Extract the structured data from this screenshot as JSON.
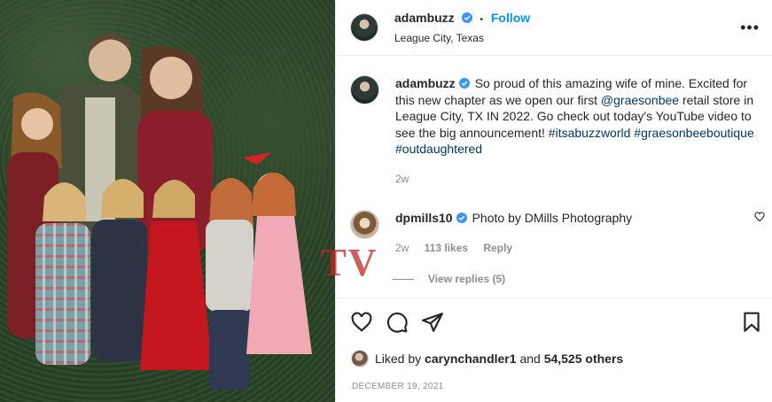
{
  "post": {
    "username": "adambuzz",
    "follow_label": "Follow",
    "location": "League City, Texas",
    "more_icon": "more-horizontal-icon"
  },
  "caption": {
    "username": "adambuzz",
    "text_before": "So proud of this amazing wife of mine. Excited for this new chapter as we open our first ",
    "mention": "@graesonbee",
    "text_after": " retail store in League City, TX IN 2022. Go check out today's YouTube video to see the big announcement! ",
    "hashtag1": "#itsabuzzworld",
    "hashtag2": "#graesonbeeboutique",
    "hashtag3": "#outdaughtered",
    "age": "2w"
  },
  "comment": {
    "username": "dpmills10",
    "text": "Photo by DMills Photography",
    "age": "2w",
    "likes": "113 likes",
    "reply_label": "Reply",
    "view_replies": "View replies (5)"
  },
  "footer": {
    "liked_by_prefix": "Liked by",
    "liked_by_user": "carynchandler1",
    "liked_by_and": "and",
    "liked_by_count": "54,525 others",
    "date": "DECEMBER 19, 2021"
  },
  "watermark": {
    "text": "TV"
  },
  "colors": {
    "follow": "#0095f6",
    "link": "#00376b",
    "verified": "#3897f0",
    "muted": "#8e8e8e"
  }
}
